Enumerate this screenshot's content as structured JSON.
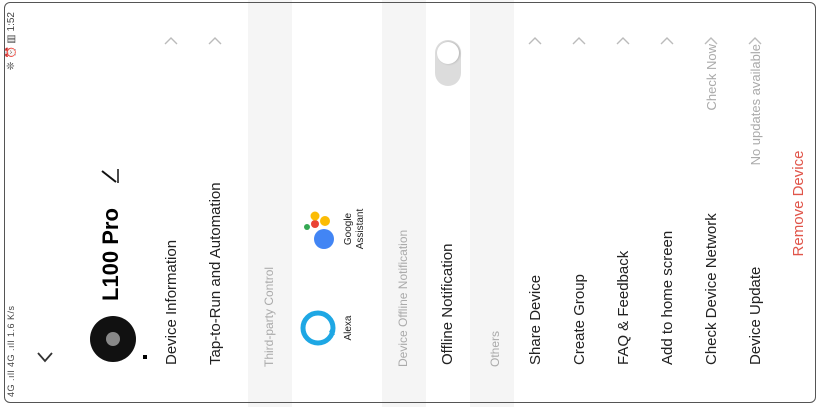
{
  "status_bar": {
    "signal_text": "4G .ıll 4G .ıll 1.6 K/s",
    "time_text": "❊ ⏰ ▥ 1:52"
  },
  "device": {
    "name": "L100 Pro"
  },
  "menu": {
    "device_information": "Device Information",
    "tap_to_run": "Tap-to-Run and Automation"
  },
  "third_party": {
    "section_title": "Third-party Control",
    "alexa": "Alexa",
    "google_line1": "Google",
    "google_line2": "Assistant"
  },
  "offline": {
    "section_title": "Device Offline Notification",
    "label": "Offline Notification",
    "toggle_state": "on"
  },
  "others": {
    "section_title": "Others",
    "share_device": "Share Device",
    "create_group": "Create Group",
    "faq": "FAQ & Feedback",
    "add_home": "Add to home screen",
    "check_network": "Check Device Network",
    "check_network_value": "Check Now",
    "device_update": "Device Update",
    "device_update_value": "No updates available"
  },
  "remove_label": "Remove Device",
  "colors": {
    "accent_red": "#e0554a",
    "alexa_blue": "#1ea7e4",
    "section_bg": "#f5f5f5"
  }
}
